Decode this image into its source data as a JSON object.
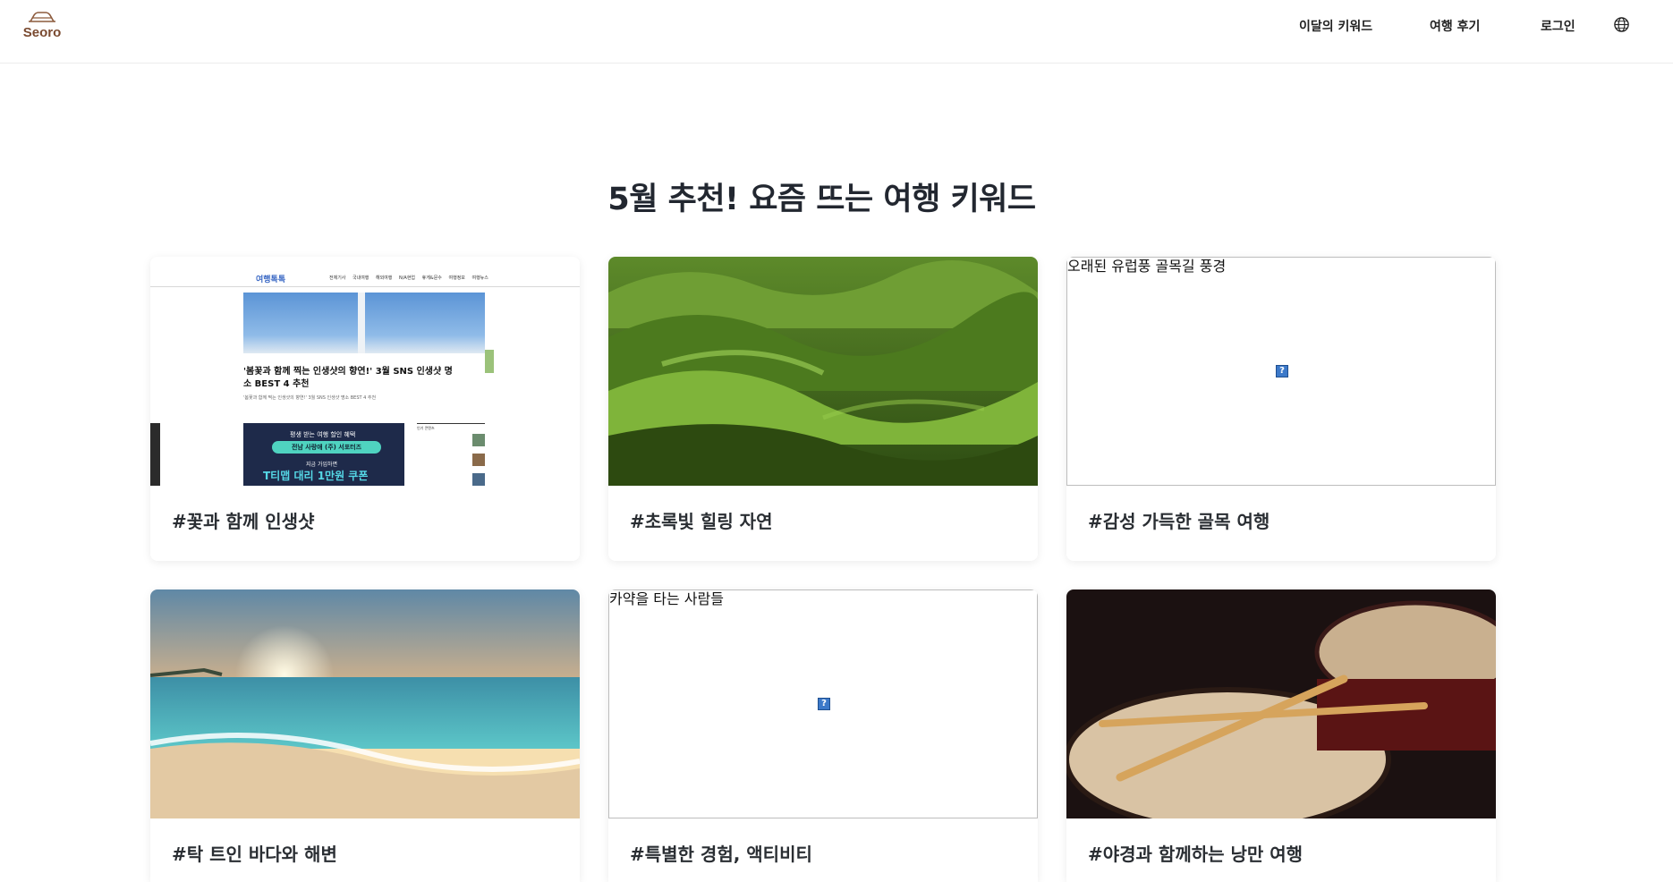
{
  "header": {
    "logo_text": "Seoro",
    "nav": [
      {
        "label": "이달의 키워드"
      },
      {
        "label": "여행 후기"
      },
      {
        "label": "로그인"
      }
    ],
    "language_icon": "globe-icon"
  },
  "section": {
    "title": "5월 추천! 요즘 뜨는 여행 키워드"
  },
  "cards": [
    {
      "keyword": "#꽃과 함께 인생샷",
      "thumb_type": "website-screenshot",
      "thumb_text": {
        "brand": "여행톡톡",
        "menu": "전체기사 국내여행 해외여행 N/A현업 휴게&문수 여행정보 여행뉴스",
        "headline": "'봄꽃과 함께 찍는 인생샷의 향연!' 3월 SNS 인생샷 명소 BEST 4 추천",
        "sub": "'봄꽃과 함께 찍는 인생샷의 향연!' 3월 SNS 인생샷 명소 BEST 4 추천",
        "banner_line1": "평생 받는 여행 할인 혜택",
        "banner_pill": "전남 사랑애 (주) 서포터즈",
        "banner_line2": "지금 가입하면",
        "banner_line3": "T티맵 대리 1만원 쿠폰",
        "side_title": "인기 콘텐츠"
      }
    },
    {
      "keyword": "#초록빛 힐링 자연",
      "thumb_type": "photo-green-hills"
    },
    {
      "keyword": "#감성 가득한 골목 여행",
      "thumb_type": "broken-image",
      "alt": "오래된 유럽풍 골목길 풍경"
    },
    {
      "keyword": "#탁 트인 바다와 해변",
      "thumb_type": "photo-beach-sunset"
    },
    {
      "keyword": "#특별한 경험, 액티비티",
      "thumb_type": "broken-image",
      "alt": "카약을 타는 사람들"
    },
    {
      "keyword": "#야경과 함께하는 낭만 여행",
      "thumb_type": "photo-drums"
    }
  ],
  "colors": {
    "logo": "#8c5a3c",
    "title": "#222730",
    "card_text": "#2a2e33",
    "divider": "#ececec"
  }
}
